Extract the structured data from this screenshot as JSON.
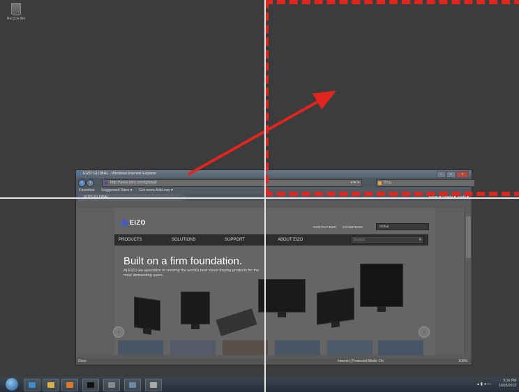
{
  "desktop": {
    "recycle_bin_label": "Recycle Bin"
  },
  "ie_window": {
    "title": "EIZO GLOBAL - Windows Internet Explorer",
    "address_url": "http://www.eizo.com/global/",
    "search_placeholder": "Bing",
    "favorites_label": "Favorites",
    "suggested_sites_label": "Suggested Sites ▾",
    "addons_label": "Get more Add-ons ▾",
    "tab_label": "EIZO GLOBAL",
    "command_bar": "Page ▾  Safety ▾  Tools ▾",
    "status_left": "Done",
    "status_zone": "Internet | Protected Mode: On",
    "zoom_level": "100%"
  },
  "eizo_page": {
    "logo_text": "EIZO",
    "top_links": [
      "CONTACT EIZO",
      "EXHIBITIONS"
    ],
    "region_selector": "Global",
    "nav_items": [
      "PRODUCTS",
      "SOLUTIONS",
      "SUPPORT",
      "ABOUT EIZO"
    ],
    "nav_search_placeholder": "Search",
    "hero_title": "Built on a firm foundation.",
    "hero_subtitle": "At EIZO we specialize in creating the world's best visual display products for the most demanding users."
  },
  "taskbar": {
    "clock_time": "9:16 PM",
    "clock_date": "10/25/2013"
  },
  "colors": {
    "annotation_red": "#e0261e",
    "crosshair": "#e8e8e8"
  }
}
